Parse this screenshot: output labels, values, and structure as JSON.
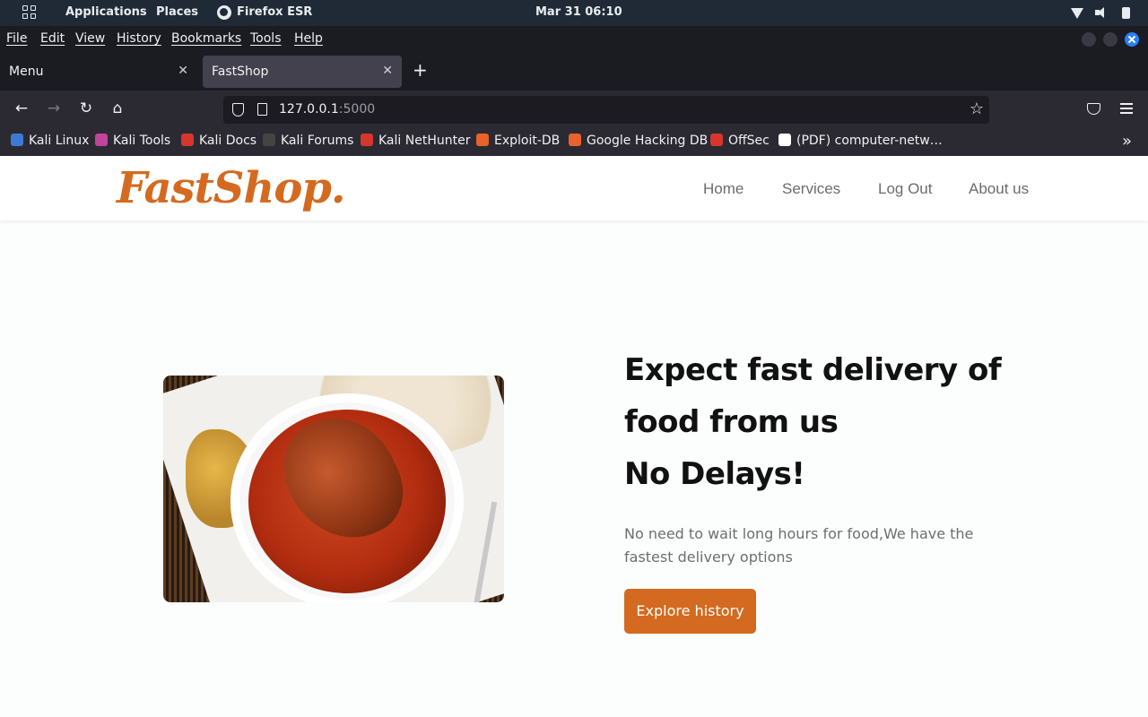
{
  "system_panel": {
    "applications": "Applications",
    "places": "Places",
    "active_app": "Firefox ESR",
    "clock": "Mar 31  06:10"
  },
  "browser": {
    "menu": [
      "File",
      "Edit",
      "View",
      "History",
      "Bookmarks",
      "Tools",
      "Help"
    ],
    "tabs": [
      {
        "label": "Menu",
        "active": false
      },
      {
        "label": "FastShop",
        "active": true
      }
    ],
    "url_host": "127.0.0.1",
    "url_port": ":5000",
    "bookmarks": [
      {
        "label": "Kali Linux",
        "icon_color": "#3d7ad6"
      },
      {
        "label": "Kali Tools",
        "icon_color": "#c0449a"
      },
      {
        "label": "Kali Docs",
        "icon_color": "#d6362c"
      },
      {
        "label": "Kali Forums",
        "icon_color": "#444444"
      },
      {
        "label": "Kali NetHunter",
        "icon_color": "#d6362c"
      },
      {
        "label": "Exploit-DB",
        "icon_color": "#e8622a"
      },
      {
        "label": "Google Hacking DB",
        "icon_color": "#e8622a"
      },
      {
        "label": "OffSec",
        "icon_color": "#d6362c"
      },
      {
        "label": "(PDF) computer-netw…",
        "icon_color": "#ffffff"
      }
    ]
  },
  "site": {
    "logo": "FastShop.",
    "nav": [
      "Home",
      "Services",
      "Log Out",
      "About us"
    ],
    "hero": {
      "title_lines": [
        "Expect fast delivery of",
        "food from us",
        "No Delays!"
      ],
      "description": "No need to wait long hours for food,We have the fastest delivery options",
      "cta": "Explore history"
    },
    "brand_color": "#d46a1f"
  }
}
